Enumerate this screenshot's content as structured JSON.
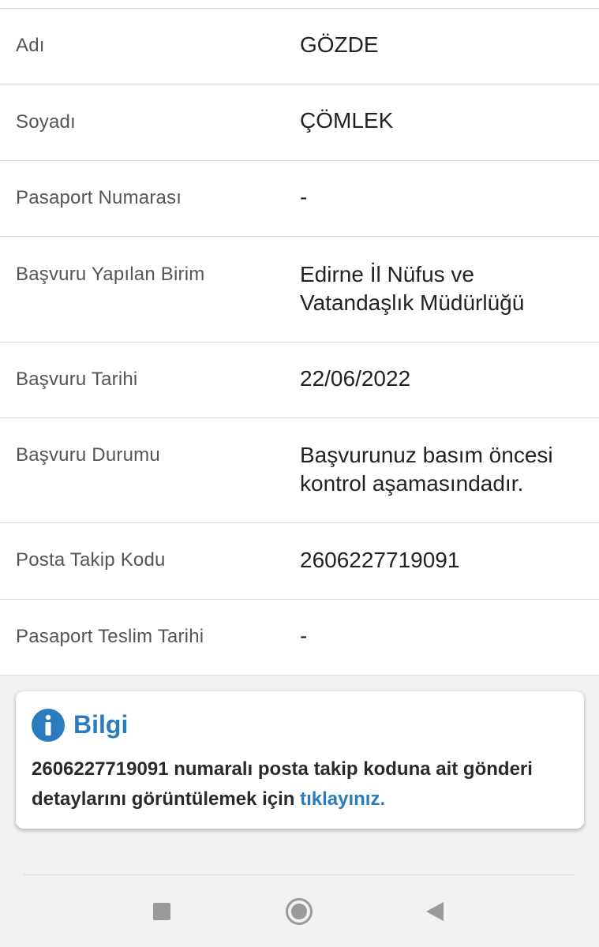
{
  "details": [
    {
      "label": "Adı",
      "value": "GÖZDE"
    },
    {
      "label": "Soyadı",
      "value": "ÇÖMLEK"
    },
    {
      "label": "Pasaport Numarası",
      "value": "-"
    },
    {
      "label": "Başvuru Yapılan Birim",
      "value": "Edirne İl Nüfus ve Vatandaşlık Müdürlüğü"
    },
    {
      "label": "Başvuru Tarihi",
      "value": "22/06/2022"
    },
    {
      "label": "Başvuru Durumu",
      "value": "Başvurunuz basım öncesi kontrol aşamasındadır."
    },
    {
      "label": "Posta Takip Kodu",
      "value": "2606227719091"
    },
    {
      "label": "Pasaport Teslim Tarihi",
      "value": "-"
    }
  ],
  "info": {
    "title": "Bilgi",
    "message": "2606227719091 numaralı posta takip koduna ait gönderi detaylarını görüntülemek için ",
    "link_text": "tıklayınız.",
    "accent_color": "#2b7bbf",
    "icon": "info-icon"
  },
  "navbar": {
    "buttons": [
      "recents-icon",
      "home-icon",
      "back-icon"
    ]
  }
}
